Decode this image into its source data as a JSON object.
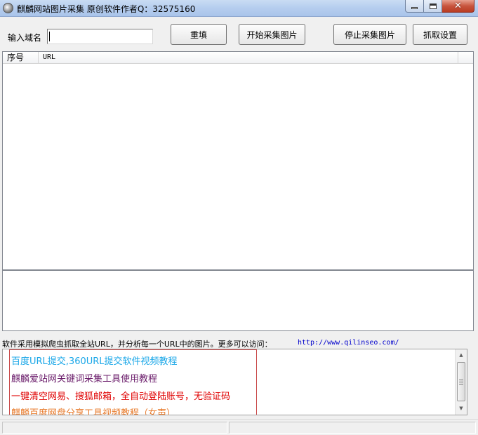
{
  "window": {
    "title": "麒麟网站图片采集 原创软件作者Q：32575160"
  },
  "toolbar": {
    "domain_label": "输入域名",
    "domain_value": "",
    "reset_label": "重填",
    "start_label": "开始采集图片",
    "stop_label": "停止采集图片",
    "settings_label": "抓取设置"
  },
  "table": {
    "columns": [
      "序号",
      "URL"
    ],
    "rows": []
  },
  "info": {
    "text": "软件采用模拟爬虫抓取全站URL，并分析每一个URL中的图片。更多可以访问：",
    "url": "http://www.qilinseo.com/"
  },
  "links": [
    {
      "text": "百度URL提交,360URL提交软件视频教程",
      "color": "#1aa7e8"
    },
    {
      "text": "麒麟爱站网关键词采集工具使用教程",
      "color": "#6a1b6a"
    },
    {
      "text": "一键清空网易、搜狐邮箱，全自动登陆账号，无验证码",
      "color": "#e00000"
    },
    {
      "text": "麒麟百度网盘分享工具视频教程（女声）",
      "color": "#e87a2a"
    }
  ],
  "colors": {
    "links_frame": "#c84848"
  }
}
